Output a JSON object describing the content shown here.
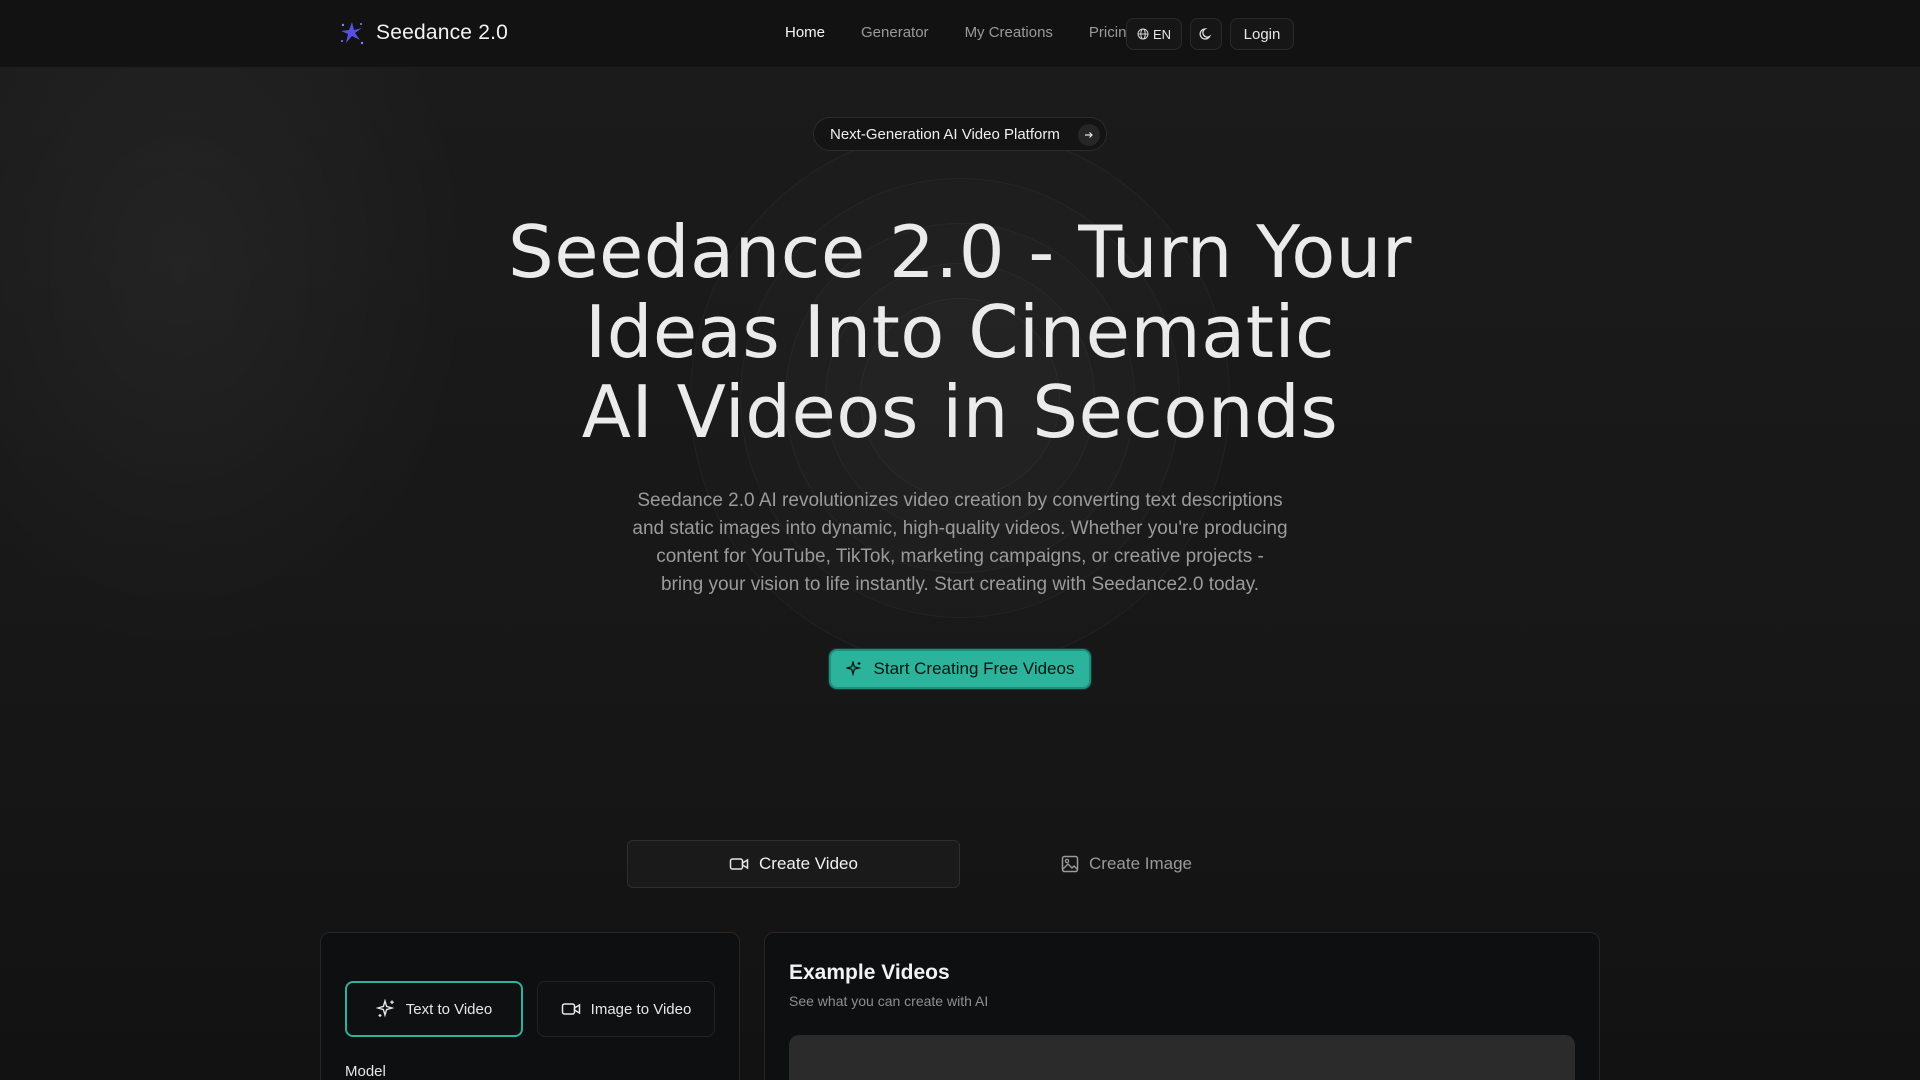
{
  "header": {
    "logo_text": "Seedance 2.0",
    "nav": [
      {
        "label": "Home",
        "active": true
      },
      {
        "label": "Generator",
        "active": false
      },
      {
        "label": "My Creations",
        "active": false
      },
      {
        "label": "Pricing",
        "active": false
      }
    ],
    "lang_label": "EN",
    "login_label": "Login"
  },
  "hero": {
    "badge_text": "Next-Generation AI Video Platform",
    "title_lines": [
      "Seedance 2.0 - Turn Your",
      "Ideas Into Cinematic",
      "AI Videos in Seconds"
    ],
    "description_lines": [
      "Seedance 2.0 AI revolutionizes video creation by converting text descriptions",
      "and static images into dynamic, high-quality videos. Whether you're producing",
      "content for YouTube, TikTok, marketing campaigns, or creative projects -",
      "bring your vision to life instantly. Start creating with Seedance2.0 today."
    ],
    "cta_label": "Start Creating Free Videos"
  },
  "mode_tabs": {
    "create_video": "Create Video",
    "create_image": "Create Image"
  },
  "generator": {
    "text_to_video": "Text to Video",
    "image_to_video": "Image to Video",
    "model_label": "Model"
  },
  "examples": {
    "title": "Example Videos",
    "subtitle": "See what you can create with AI"
  },
  "colors": {
    "accent": "#2bb39b",
    "background": "#161616",
    "panel": "#0e0f10",
    "logo": "#5b4ee6"
  }
}
